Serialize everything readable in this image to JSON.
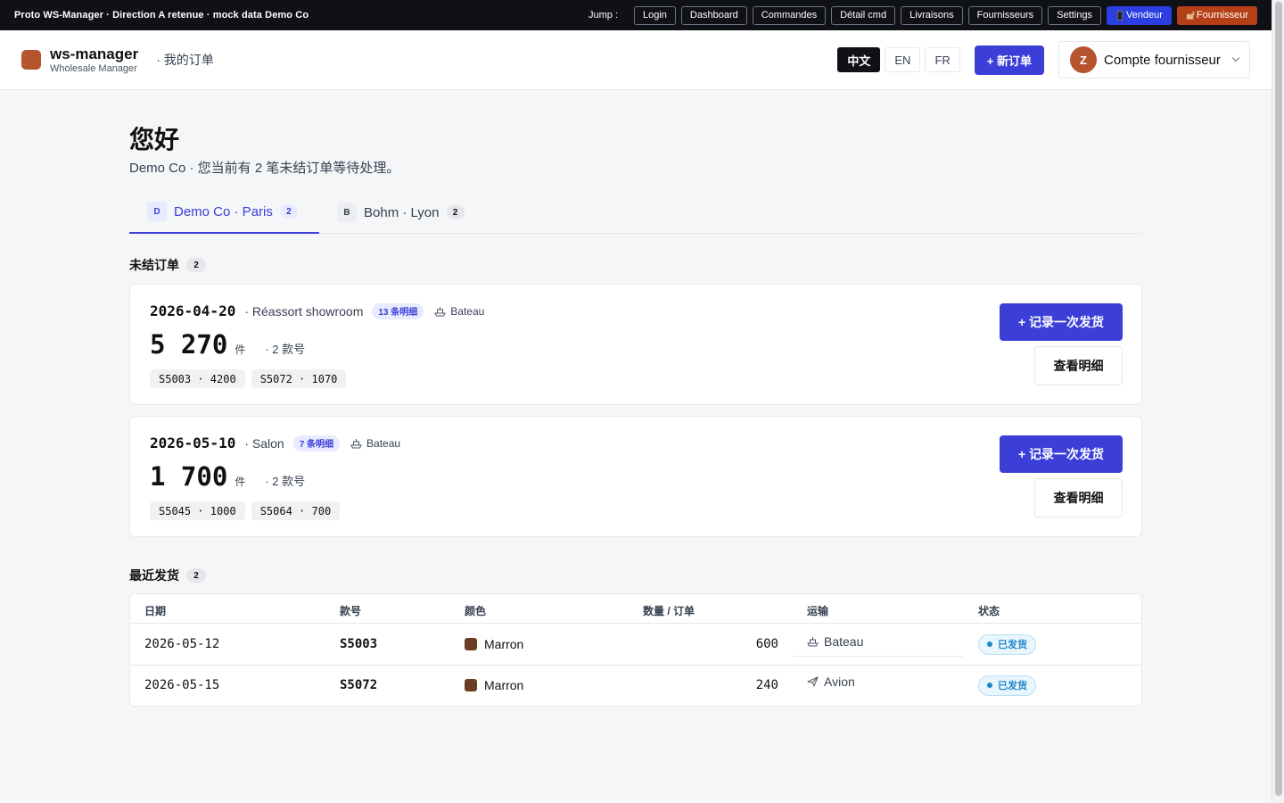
{
  "proto_bar": {
    "title": "Proto WS-Manager · Direction A retenue · mock data Demo Co",
    "jump_label": "Jump :",
    "links": [
      "Login",
      "Dashboard",
      "Commandes",
      "Détail cmd",
      "Livraisons",
      "Fournisseurs",
      "Settings"
    ],
    "vendeur": "Vendeur",
    "fournisseur": "Fournisseur"
  },
  "header": {
    "brand_name": "ws-manager",
    "brand_sub": "Wholesale Manager",
    "breadcrumb": "· 我的订单",
    "languages": [
      "中文",
      "EN",
      "FR"
    ],
    "active_language": "中文",
    "new_order": "+ 新订单",
    "account_initial": "Z",
    "account_name": "Compte fournisseur"
  },
  "greeting": {
    "title": "您好",
    "subtitle": "Demo Co · 您当前有 2 笔未结订单等待处理。"
  },
  "tabs": [
    {
      "icon": "D",
      "label": "Demo Co · Paris",
      "count": "2",
      "active": true
    },
    {
      "icon": "B",
      "label": "Bohm · Lyon",
      "count": "2",
      "active": false
    }
  ],
  "open_orders": {
    "title": "未结订单",
    "count": "2",
    "record_label": "+ 记录一次发货",
    "detail_label": "查看明细",
    "orders": [
      {
        "date": "2026-04-20",
        "label": "· Réassort showroom",
        "lines": "13 条明细",
        "transport": "Bateau",
        "qty": "5 270",
        "unit": "件",
        "styles": "· 2 款号",
        "chips": [
          "S5003 · 4200",
          "S5072 · 1070"
        ]
      },
      {
        "date": "2026-05-10",
        "label": "· Salon",
        "lines": "7 条明细",
        "transport": "Bateau",
        "qty": "1 700",
        "unit": "件",
        "styles": "· 2 款号",
        "chips": [
          "S5045 · 1000",
          "S5064 · 700"
        ]
      }
    ]
  },
  "recent_shipments": {
    "title": "最近发货",
    "count": "2",
    "columns": [
      "日期",
      "款号",
      "颜色",
      "数量 / 订单",
      "运输",
      "状态"
    ],
    "rows": [
      {
        "date": "2026-05-12",
        "style": "S5003",
        "color": "Marron",
        "color_hex": "#6b3d23",
        "qty": "600",
        "transport": "Bateau",
        "transport_icon": "ship-icon",
        "status": "已发货"
      },
      {
        "date": "2026-05-15",
        "style": "S5072",
        "color": "Marron",
        "color_hex": "#6b3d23",
        "qty": "240",
        "transport": "Avion",
        "transport_icon": "plane-icon",
        "status": "已发货"
      }
    ]
  },
  "colors": {
    "accent": "#3b3fd8",
    "brand": "#b5542f",
    "status": "#1f86c8"
  }
}
